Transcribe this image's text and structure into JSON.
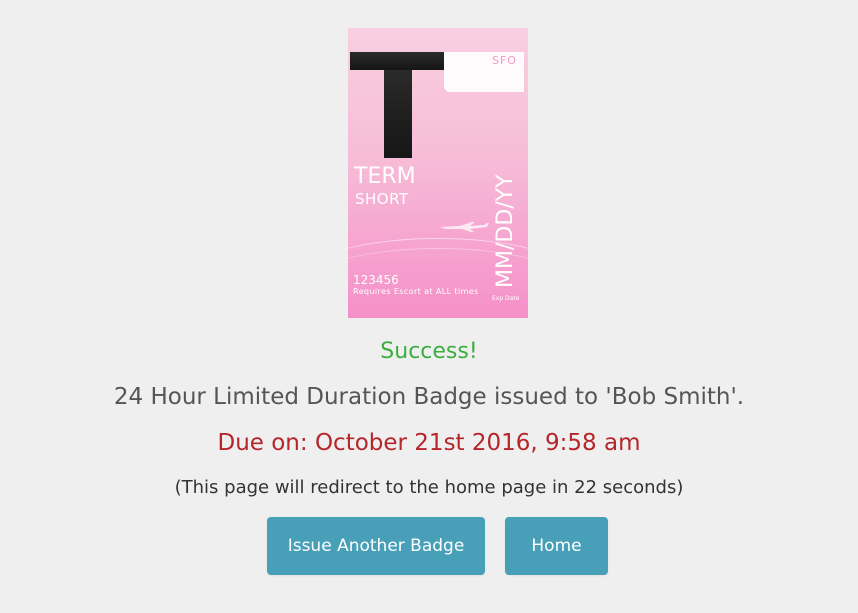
{
  "badge": {
    "letter": "T",
    "airport": "SFO",
    "term": "TERM",
    "duration": "SHORT",
    "date": "MM/DD/YY",
    "badge_number": "123456",
    "escort_note": "Requires Escort at ALL times",
    "exp_label": "Exp Date",
    "plane_icon": "plane-icon"
  },
  "messages": {
    "success": "Success!",
    "issued": "24 Hour Limited Duration Badge issued to 'Bob Smith'.",
    "due": "Due on: October 21st 2016, 9:58 am",
    "redirect": "(This page will redirect to the home page in 22 seconds)"
  },
  "actions": {
    "issue_another": "Issue Another Badge",
    "home": "Home"
  },
  "colors": {
    "page_bg": "#efefef",
    "success": "#3cae3f",
    "due": "#b5252a",
    "button": "#479fb8"
  }
}
